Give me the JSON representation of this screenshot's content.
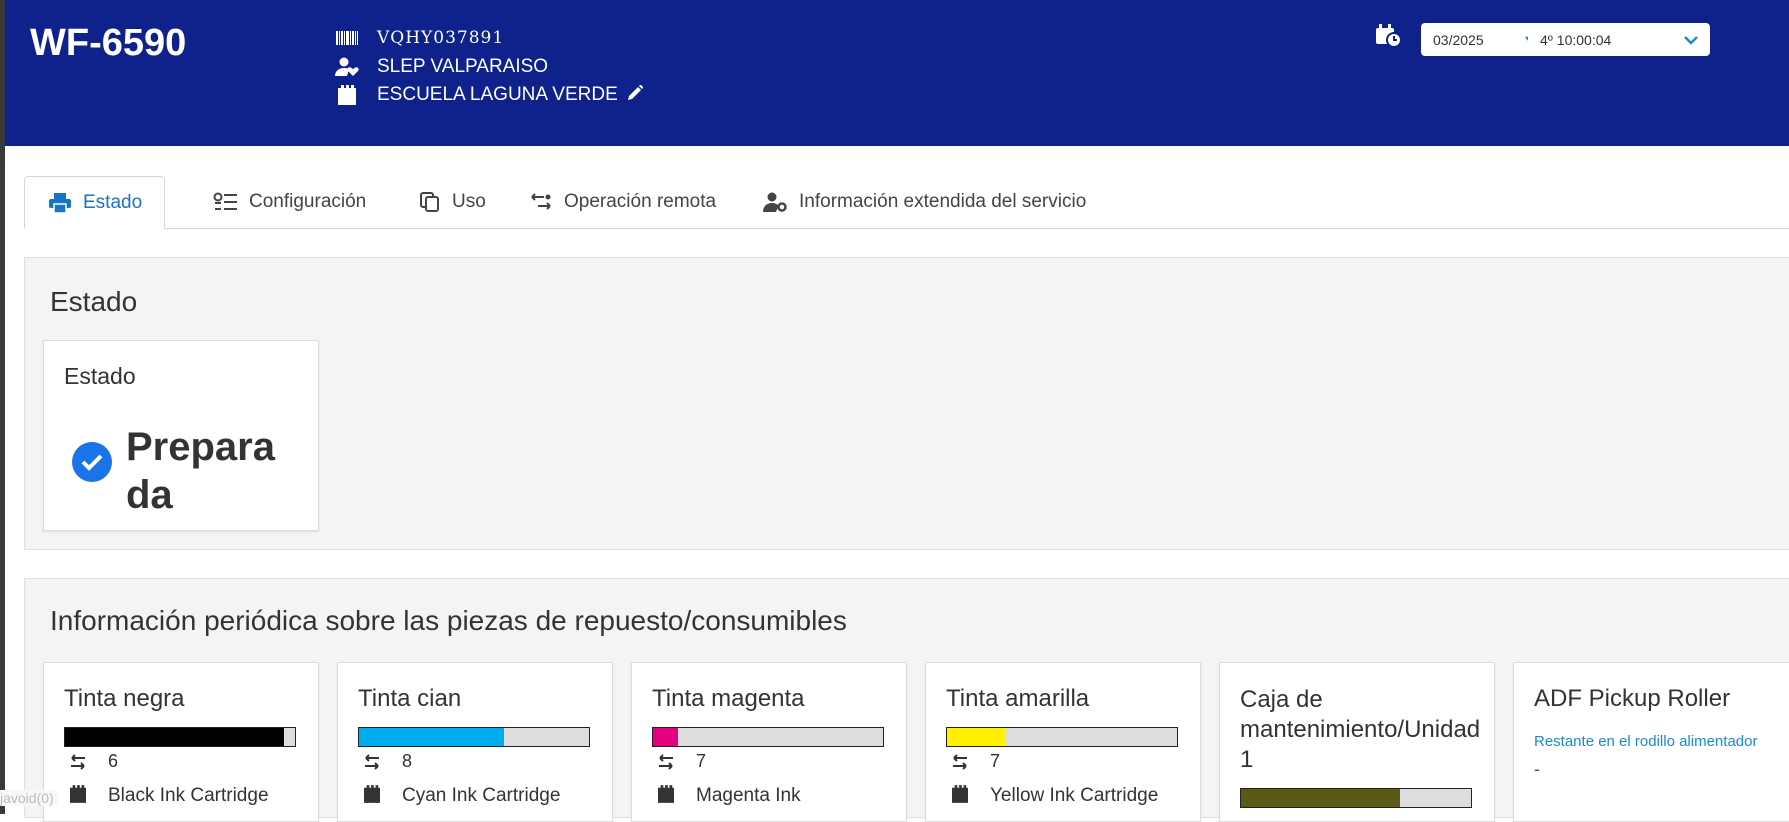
{
  "header": {
    "model": "WF-6590",
    "serial": "VQHY037891",
    "organization": "SLEP VALPARAISO",
    "location": "ESCUELA LAGUNA VERDE",
    "month_select": "03/2025",
    "time_select": "4º 10:00:04"
  },
  "tabs": [
    {
      "label": "Estado",
      "active": true
    },
    {
      "label": "Configuración"
    },
    {
      "label": "Uso"
    },
    {
      "label": "Operación remota"
    },
    {
      "label": "Información extendida del servicio"
    }
  ],
  "status_section": {
    "title": "Estado",
    "card_title": "Estado",
    "value": "Preparada"
  },
  "consumables_section": {
    "title": "Información periódica sobre las piezas de repuesto/consumibles",
    "items": [
      {
        "title": "Tinta negra",
        "level_percent": 95,
        "color": "#000000",
        "count": "6",
        "cartridge": "Black Ink Cartridge"
      },
      {
        "title": "Tinta cian",
        "level_percent": 63,
        "color": "#00aeef",
        "count": "8",
        "cartridge": "Cyan Ink Cartridge"
      },
      {
        "title": "Tinta magenta",
        "level_percent": 11,
        "color": "#e5007e",
        "count": "7",
        "cartridge": "Magenta Ink"
      },
      {
        "title": "Tinta amarilla",
        "level_percent": 25,
        "color": "#fff100",
        "count": "7",
        "cartridge": "Yellow Ink Cartridge"
      },
      {
        "title": "Caja de mantenimiento/Unidad 1",
        "level_percent": 69,
        "color": "#5b5a14"
      },
      {
        "title": "ADF Pickup Roller",
        "link": "Restante en el rodillo alimentador",
        "value": "-"
      }
    ]
  },
  "footer": {
    "void_text": "javoid(0)"
  }
}
